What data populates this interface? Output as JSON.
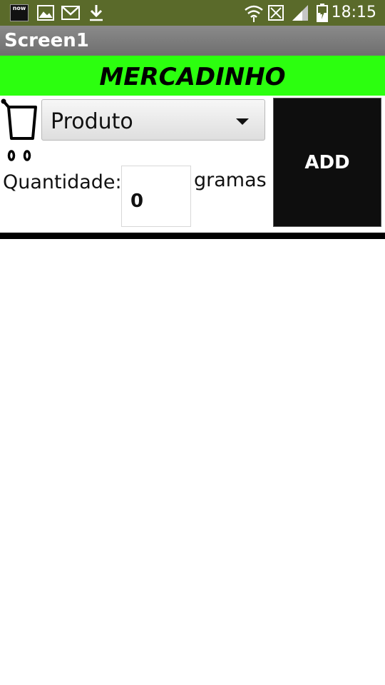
{
  "status_bar": {
    "time": "18:15",
    "app_icon_text": "now",
    "background": "#5a6a2a",
    "icons": [
      "news-app-icon",
      "gallery-icon",
      "gmail-icon",
      "download-icon",
      "wifi-icon",
      "sim-message-icon",
      "signal-icon",
      "battery-charging-icon"
    ]
  },
  "title_bar": {
    "title": "Screen1"
  },
  "banner": {
    "text": "MERCADINHO",
    "color": "#2cff0f"
  },
  "product_selector": {
    "selected": "Produto"
  },
  "quantity": {
    "label": "Quantidade:",
    "value": "0",
    "unit": "gramas"
  },
  "add_button": {
    "label": "ADD",
    "color": "#0e0e0e"
  },
  "colors": {
    "title_bar": "#7a7a7a",
    "divider": "#000000"
  }
}
